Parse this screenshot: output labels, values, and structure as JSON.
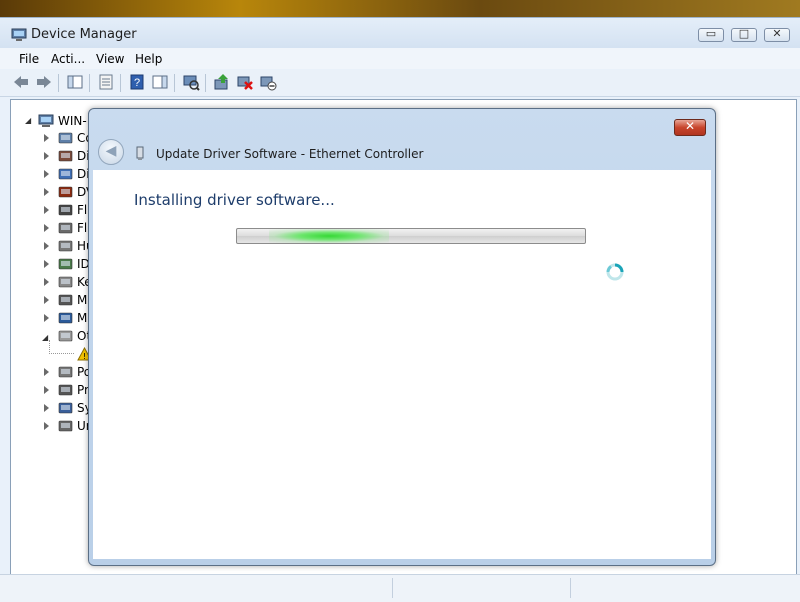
{
  "window": {
    "title": "Device Manager",
    "minimize_glyph": "▭",
    "maximize_glyph": "□",
    "close_glyph": "✕"
  },
  "menu": [
    "File",
    "Acti...",
    "View",
    "Help"
  ],
  "toolbar": [
    "back-icon",
    "forward-icon",
    "show-hide-console-tree-icon",
    "properties-icon",
    "help-icon",
    "action-pane-icon",
    "scan-hardware-icon",
    "update-driver-icon",
    "uninstall-icon",
    "disable-icon"
  ],
  "tree": {
    "root": "WIN-",
    "items": [
      {
        "label": "Co",
        "icon": "computer-icon"
      },
      {
        "label": "Di",
        "icon": "disk-drive-icon"
      },
      {
        "label": "Di",
        "icon": "display-adapter-icon"
      },
      {
        "label": "DV",
        "icon": "dvd-drive-icon"
      },
      {
        "label": "Fl",
        "icon": "floppy-controller-icon"
      },
      {
        "label": "Fl",
        "icon": "floppy-drive-icon"
      },
      {
        "label": "Hu",
        "icon": "hid-icon"
      },
      {
        "label": "ID",
        "icon": "ide-controller-icon"
      },
      {
        "label": "Ke",
        "icon": "keyboard-icon"
      },
      {
        "label": "M",
        "icon": "mouse-icon"
      },
      {
        "label": "M",
        "icon": "monitor-icon"
      },
      {
        "label": "Ot",
        "icon": "other-devices-icon"
      },
      {
        "label": "",
        "icon": "unknown-device-warning-icon"
      },
      {
        "label": "Po",
        "icon": "ports-icon"
      },
      {
        "label": "Pr",
        "icon": "processor-icon"
      },
      {
        "label": "Sy",
        "icon": "system-devices-icon"
      },
      {
        "label": "Ur",
        "icon": "usb-controller-icon"
      }
    ]
  },
  "dialog": {
    "title": "Update Driver Software - Ethernet Controller",
    "heading": "Installing driver software...",
    "close_glyph": "✕",
    "back_glyph": "◀",
    "progress_state": "indeterminate",
    "accent_color": "#1e3d6b",
    "progress_color": "#36d836"
  }
}
